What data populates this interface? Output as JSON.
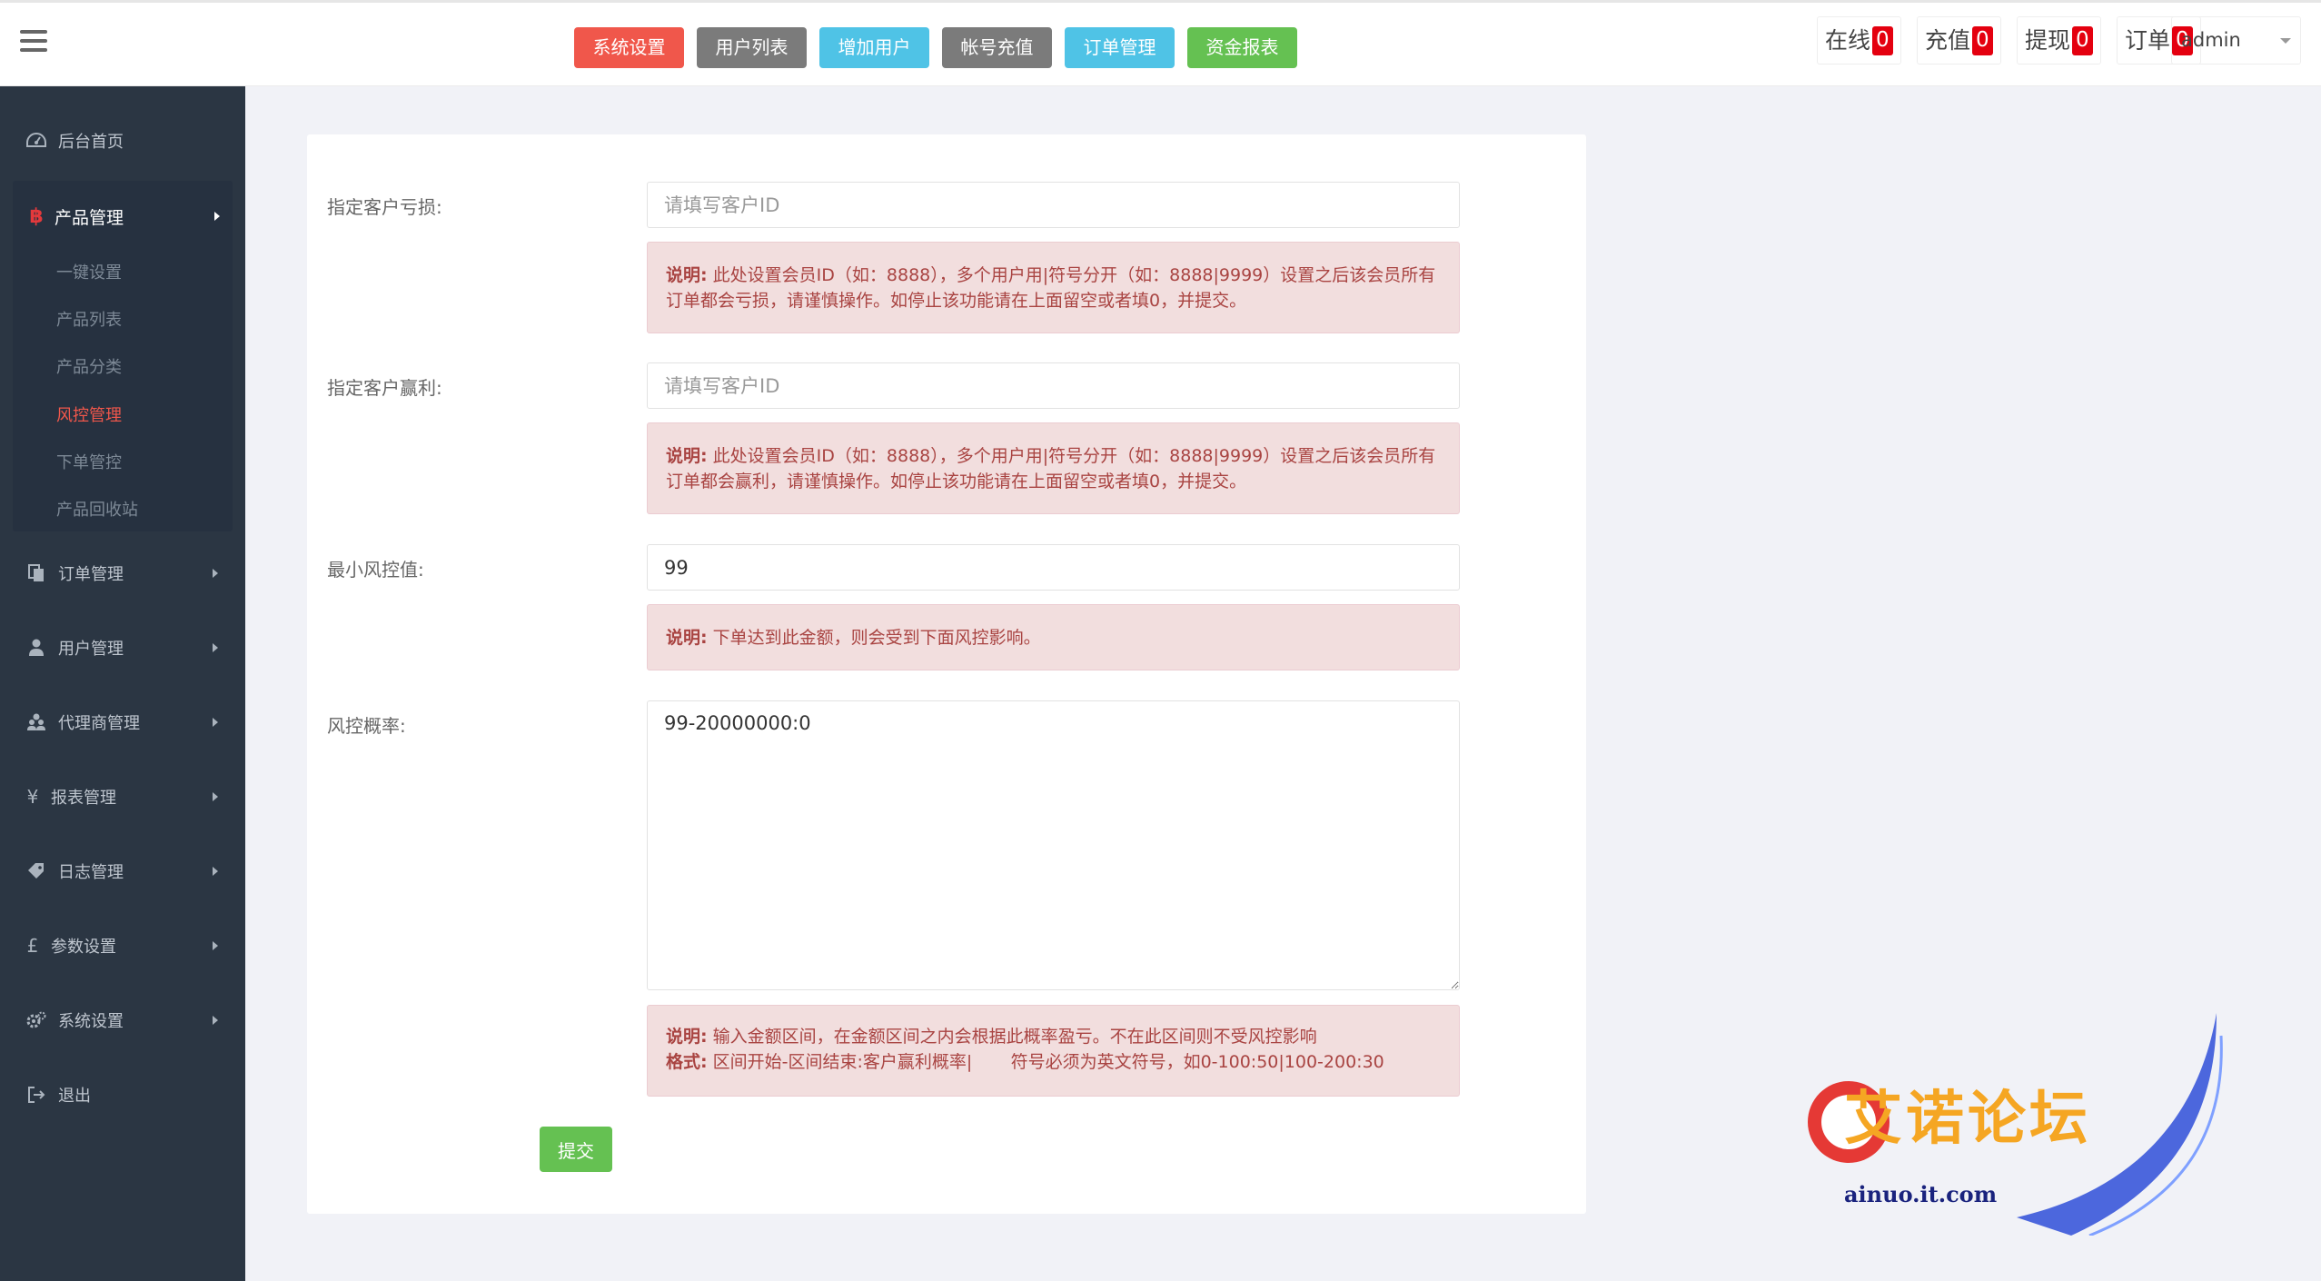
{
  "topbar": {
    "buttons": [
      {
        "label": "系统设置",
        "color": "#f0574b"
      },
      {
        "label": "用户列表",
        "color": "#7b7b7b"
      },
      {
        "label": "增加用户",
        "color": "#4fc3e6"
      },
      {
        "label": "帐号充值",
        "color": "#7b7b7b"
      },
      {
        "label": "订单管理",
        "color": "#4fc3e6"
      },
      {
        "label": "资金报表",
        "color": "#65c152"
      }
    ],
    "counters": [
      {
        "label": "在线",
        "value": "0"
      },
      {
        "label": "充值",
        "value": "0"
      },
      {
        "label": "提现",
        "value": "0"
      },
      {
        "label": "订单",
        "value": "0"
      }
    ],
    "user": "admin"
  },
  "sidebar": {
    "home": "后台首页",
    "product": {
      "label": "产品管理",
      "children": [
        "一键设置",
        "产品列表",
        "产品分类",
        "风控管理",
        "下单管控",
        "产品回收站"
      ],
      "active_index": 3
    },
    "items": [
      {
        "label": "订单管理",
        "icon": "copy-icon"
      },
      {
        "label": "用户管理",
        "icon": "user-icon"
      },
      {
        "label": "代理商管理",
        "icon": "users-icon"
      },
      {
        "label": "报表管理",
        "icon": "yen-icon"
      },
      {
        "label": "日志管理",
        "icon": "tag-icon"
      },
      {
        "label": "参数设置",
        "icon": "pound-icon"
      },
      {
        "label": "系统设置",
        "icon": "gears-icon"
      }
    ],
    "logout": "退出"
  },
  "form": {
    "loss": {
      "label": "指定客户亏损:",
      "placeholder": "请填写客户ID",
      "note_title": "说明:",
      "note_text": "此处设置会员ID（如：8888），多个用户用|符号分开（如：8888|9999）设置之后该会员所有订单都会亏损，请谨慎操作。如停止该功能请在上面留空或者填0，并提交。"
    },
    "profit": {
      "label": "指定客户赢利:",
      "placeholder": "请填写客户ID",
      "note_title": "说明:",
      "note_text": "此处设置会员ID（如：8888），多个用户用|符号分开（如：8888|9999）设置之后该会员所有订单都会赢利，请谨慎操作。如停止该功能请在上面留空或者填0，并提交。"
    },
    "min_risk": {
      "label": "最小风控值:",
      "value": "99",
      "note_title": "说明:",
      "note_text": "下单达到此金额，则会受到下面风控影响。"
    },
    "probability": {
      "label": "风控概率:",
      "value": "99-20000000:0",
      "note_title": "说明:",
      "note_text": "输入金额区间，在金额区间之内会根据此概率盈亏。不在此区间则不受风控影响",
      "format_title": "格式:",
      "format_text": "区间开始-区间结束:客户赢利概率|       符号必须为英文符号，如0-100:50|100-200:30"
    },
    "submit": "提交"
  },
  "watermark": {
    "title": "艾诺论坛",
    "url": "ainuo.it.com"
  }
}
